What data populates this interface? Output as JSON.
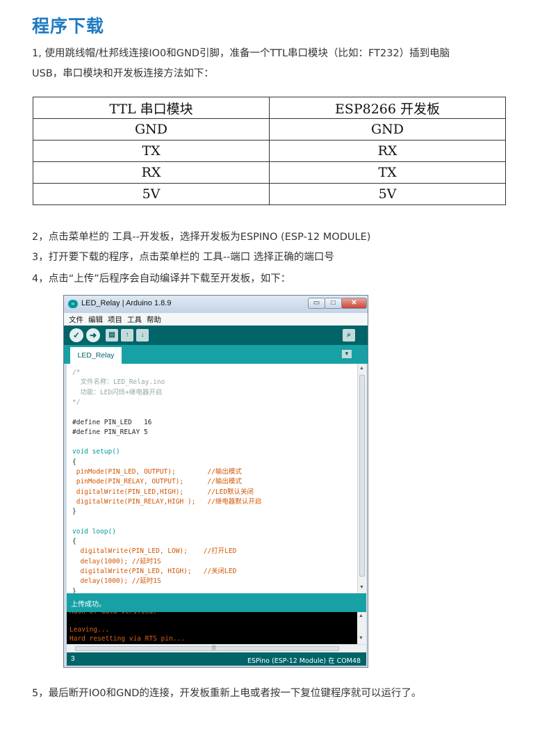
{
  "heading": "程序下载",
  "intro": {
    "line1": "1, 使用跳线帽/杜邦线连接IO0和GND引脚，准备一个TTL串口模块（比如：FT232）插到电脑",
    "line2": "USB，串口模块和开发板连接方法如下："
  },
  "pin_table": {
    "headers": [
      "TTL 串口模块",
      "ESP8266 开发板"
    ],
    "rows": [
      [
        "GND",
        "GND"
      ],
      [
        "TX",
        "RX"
      ],
      [
        "RX",
        "TX"
      ],
      [
        "5V",
        "5V"
      ]
    ]
  },
  "steps": {
    "s2": "2，点击菜单栏的 工具--开发板，选择开发板为ESPINO (ESP-12 MODULE)",
    "s3": "3，打开要下载的程序，点击菜单栏的 工具--端口 选择正确的端口号",
    "s4": "4，点击“上传”后程序会自动编译并下载至开发板，如下：",
    "s5": "5，最后断开IO0和GND的连接，开发板重新上电或者按一下复位键程序就可以运行了。"
  },
  "ide": {
    "window_title": "LED_Relay | Arduino 1.8.9",
    "window_buttons": {
      "minimize": "▭",
      "maximize": "□",
      "close": "✕"
    },
    "menu": [
      "文件",
      "编辑",
      "项目",
      "工具",
      "帮助"
    ],
    "toolbar_icons": [
      "verify-icon",
      "upload-icon",
      "new-icon",
      "open-icon",
      "save-icon",
      "serial-monitor-icon"
    ],
    "tab_label": "LED_Relay",
    "code_lines": [
      {
        "text": "/*",
        "color": "#95a5a6"
      },
      {
        "text": "  文件名称：LED_Relay.ino",
        "color": "#95a5a6"
      },
      {
        "text": "  功能：LED闪烁+继电器开启",
        "color": "#95a5a6"
      },
      {
        "text": "*/",
        "color": "#95a5a6"
      },
      {
        "text": "",
        "color": "#222222"
      },
      {
        "text": "#define PIN_LED   16",
        "color": "#222222"
      },
      {
        "text": "#define PIN_RELAY 5",
        "color": "#222222"
      },
      {
        "text": "",
        "color": "#222222"
      },
      {
        "text": "void setup()",
        "color": "#00979c"
      },
      {
        "text": "{",
        "color": "#222222"
      },
      {
        "text": " pinMode(PIN_LED, OUTPUT);        //输出模式",
        "color": "#d35400"
      },
      {
        "text": " pinMode(PIN_RELAY, OUTPUT);      //输出模式",
        "color": "#d35400"
      },
      {
        "text": " digitalWrite(PIN_LED,HIGH);      //LED默认关闭",
        "color": "#d35400"
      },
      {
        "text": " digitalWrite(PIN_RELAY,HIGH );   //继电器默认开启",
        "color": "#d35400"
      },
      {
        "text": "}",
        "color": "#222222"
      },
      {
        "text": "",
        "color": "#222222"
      },
      {
        "text": "void loop()",
        "color": "#00979c"
      },
      {
        "text": "{",
        "color": "#222222"
      },
      {
        "text": "  digitalWrite(PIN_LED, LOW);    //打开LED",
        "color": "#d35400"
      },
      {
        "text": "  delay(1000); //延时1S",
        "color": "#d35400"
      },
      {
        "text": "  digitalWrite(PIN_LED, HIGH);   //关闭LED",
        "color": "#d35400"
      },
      {
        "text": "  delay(1000); //延时1S",
        "color": "#d35400"
      },
      {
        "text": "}",
        "color": "#222222"
      }
    ],
    "status_message": "上传成功。",
    "console_lines": [
      "Hash of data verified.",
      "",
      "Leaving...",
      "Hard resetting via RTS pin..."
    ],
    "line_number": "3",
    "board_info": "ESPino (ESP-12 Module) 在 COM48"
  }
}
